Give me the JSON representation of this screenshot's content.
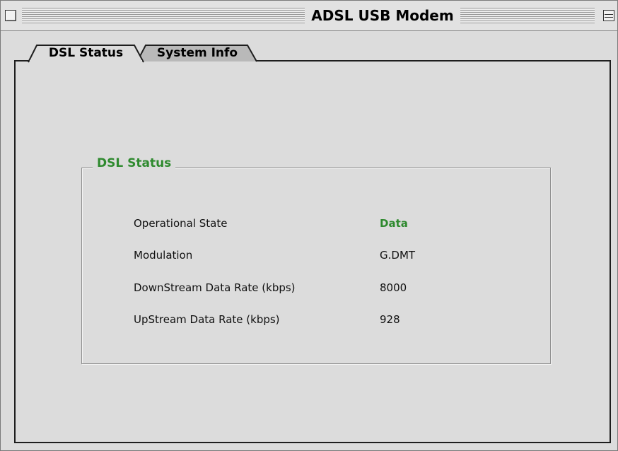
{
  "window": {
    "title": "ADSL USB Modem"
  },
  "tabs": [
    {
      "label": "DSL Status",
      "selected": true
    },
    {
      "label": "System Info",
      "selected": false
    }
  ],
  "group": {
    "title": "DSL Status",
    "rows": [
      {
        "label": "Operational State",
        "value": "Data"
      },
      {
        "label": "Modulation",
        "value": "G.DMT"
      },
      {
        "label": "DownStream Data Rate (kbps)",
        "value": "8000"
      },
      {
        "label": "UpStream Data Rate (kbps)",
        "value": "928"
      }
    ]
  },
  "colors": {
    "accent_green": "#2f8a2f",
    "window_bg": "#dcdcdc"
  },
  "icons": {
    "close": "close-box-icon",
    "collapse": "collapse-box-icon"
  }
}
